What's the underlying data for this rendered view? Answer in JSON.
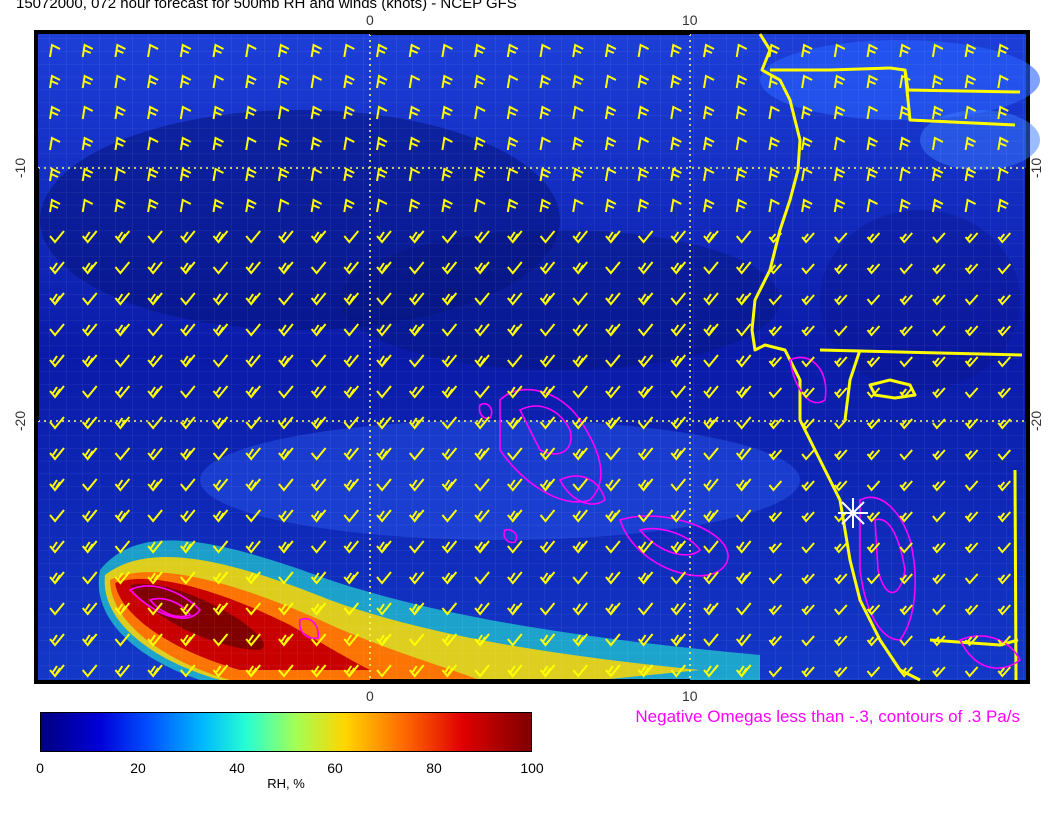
{
  "title": "15072000, 072 hour forecast for 500mb RH and winds (knots) - NCEP GFS",
  "axes": {
    "top_ticks": [
      "0",
      "10"
    ],
    "bottom_ticks": [
      "0",
      "10"
    ],
    "left_ticks": [
      "-10",
      "-20"
    ],
    "right_ticks": [
      "-10",
      "-20"
    ]
  },
  "colorbar": {
    "ticks": [
      "0",
      "20",
      "40",
      "60",
      "80",
      "100"
    ],
    "label": "RH, %",
    "colors": [
      "#00007f",
      "#0000d8",
      "#0050ff",
      "#00b8ff",
      "#27ffd3",
      "#a2ff55",
      "#ffd600",
      "#ff6a00",
      "#e00000",
      "#7f0000"
    ]
  },
  "omega_note": "Negative Omegas less than -.3, contours of .3 Pa/s",
  "overlay_colors": {
    "coast": "#ffff00",
    "barbs": "#ffff00",
    "omega": "#ff00ff",
    "grid": "#ffffaa"
  }
}
